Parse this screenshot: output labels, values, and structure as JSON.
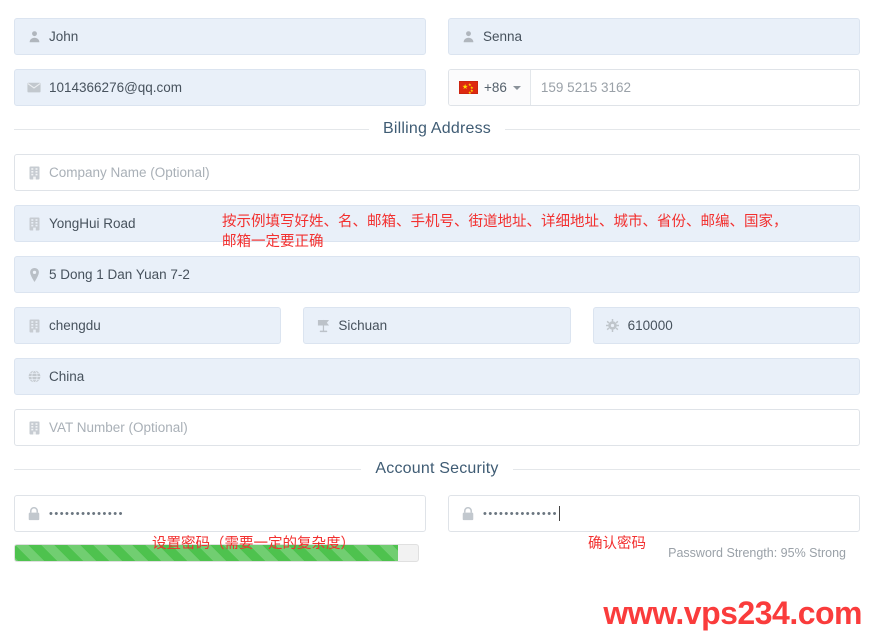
{
  "personal": {
    "first_name": {
      "icon": "user-icon",
      "value": "John"
    },
    "last_name": {
      "icon": "user-icon",
      "value": "Senna"
    },
    "email": {
      "icon": "envelope-icon",
      "value": "1014366276@qq.com"
    },
    "phone": {
      "flag": "china-flag-icon",
      "dial_code": "+86",
      "number": "159 5215 3162"
    }
  },
  "billing": {
    "section_title": "Billing Address",
    "company": {
      "icon": "building-icon",
      "placeholder": "Company Name (Optional)"
    },
    "street": {
      "icon": "building-icon",
      "value": "YongHui Road"
    },
    "address2": {
      "icon": "map-pin-icon",
      "value": "5 Dong 1 Dan Yuan 7-2"
    },
    "city": {
      "icon": "building-icon",
      "value": "chengdu"
    },
    "state": {
      "icon": "map-flag-icon",
      "value": "Sichuan"
    },
    "zip": {
      "icon": "gear-icon",
      "value": "610000"
    },
    "country": {
      "icon": "globe-icon",
      "value": "China"
    },
    "vat": {
      "icon": "building-icon",
      "placeholder": "VAT Number (Optional)"
    },
    "annotation": "按示例填写好姓、名、邮箱、手机号、街道地址、详细地址、城市、省份、邮编、国家，\n邮箱一定要正确"
  },
  "security": {
    "section_title": "Account Security",
    "password": {
      "icon": "lock-icon",
      "masked": "••••••••••••••",
      "annotation": "设置密码（需要一定的复杂度）"
    },
    "confirm_password": {
      "icon": "lock-icon",
      "masked": "••••••••••••••",
      "annotation": "确认密码"
    },
    "strength": {
      "percent": 95,
      "label": "Password Strength: 95% Strong",
      "color": "#4ec24e"
    }
  },
  "watermark": "www.vps234.com",
  "colors": {
    "filled_field_bg": "#e9f0f9",
    "section_title": "#3f5c74",
    "annotation_red": "#f2302f",
    "watermark_red": "#fa3c3c",
    "strength_green": "#4ec24e"
  }
}
